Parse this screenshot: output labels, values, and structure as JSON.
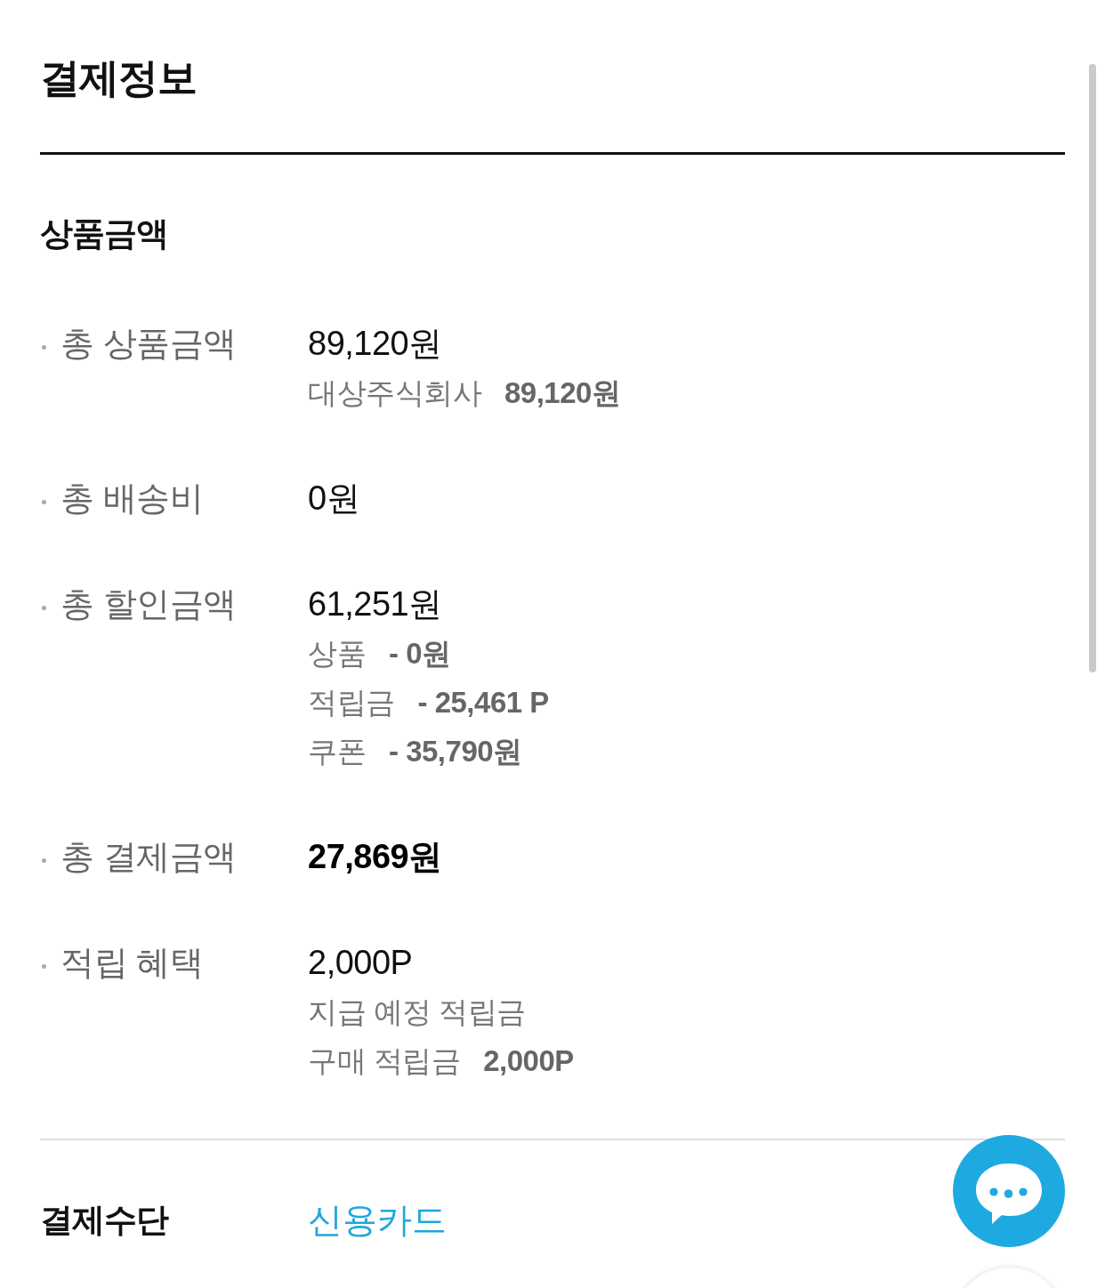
{
  "title": "결제정보",
  "product_section": {
    "heading": "상품금액",
    "rows": [
      {
        "label": "총 상품금액",
        "value": "89,120원",
        "emphasized": false,
        "details": [
          {
            "label": "대상주식회사",
            "amount": "89,120원"
          }
        ]
      },
      {
        "label": "총 배송비",
        "value": "0원",
        "emphasized": false
      },
      {
        "label": "총 할인금액",
        "value": "61,251원",
        "emphasized": false,
        "details": [
          {
            "label": "상품",
            "amount": "- 0원"
          },
          {
            "label": "적립금",
            "amount": "- 25,461 P"
          },
          {
            "label": "쿠폰",
            "amount": "- 35,790원"
          }
        ]
      },
      {
        "label": "총 결제금액",
        "value": "27,869원",
        "emphasized": true
      },
      {
        "label": "적립 혜택",
        "value": "2,000P",
        "emphasized": false,
        "details": [
          {
            "label": "지급 예정 적립금"
          },
          {
            "label": "구매 적립금",
            "amount": "2,000P"
          }
        ]
      }
    ]
  },
  "payment_method": {
    "label": "결제수단",
    "value": "신용카드"
  }
}
